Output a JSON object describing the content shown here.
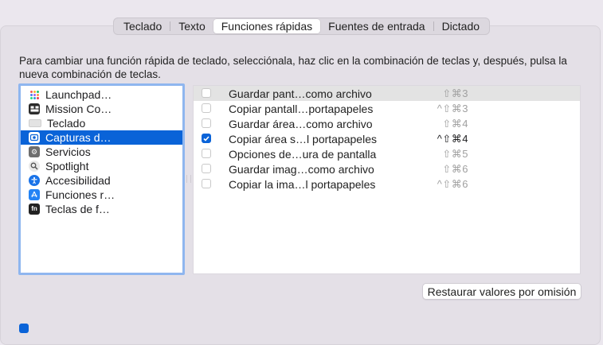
{
  "tabs": [
    {
      "label": "Teclado",
      "active": false
    },
    {
      "label": "Texto",
      "active": false
    },
    {
      "label": "Funciones rápidas",
      "active": true
    },
    {
      "label": "Fuentes de entrada",
      "active": false
    },
    {
      "label": "Dictado",
      "active": false
    }
  ],
  "instructions": "Para cambiar una función rápida de teclado, selecciónala, haz clic en la combinación de teclas y, después, pulsa la nueva combinación de teclas.",
  "categories": [
    {
      "label": "Launchpad…",
      "icon": "launchpad-icon"
    },
    {
      "label": "Mission Co…",
      "icon": "mission-control-icon"
    },
    {
      "label": "Teclado",
      "icon": "keyboard-icon"
    },
    {
      "label": "Capturas d…",
      "icon": "screenshot-icon",
      "selected": true
    },
    {
      "label": "Servicios",
      "icon": "gear-icon"
    },
    {
      "label": "Spotlight",
      "icon": "spotlight-icon"
    },
    {
      "label": "Accesibilidad",
      "icon": "accessibility-icon"
    },
    {
      "label": "Funciones r…",
      "icon": "app-store-icon"
    },
    {
      "label": "Teclas de f…",
      "icon": "fn-key-icon"
    }
  ],
  "shortcuts": [
    {
      "label": "Guardar pant…como archivo",
      "keys": "⇧⌘3",
      "checked": false
    },
    {
      "label": "Copiar pantall…portapapeles",
      "keys": "^⇧⌘3",
      "checked": false
    },
    {
      "label": "Guardar área…como archivo",
      "keys": "⇧⌘4",
      "checked": false
    },
    {
      "label": "Copiar área s…l portapapeles",
      "keys": "^⇧⌘4",
      "checked": true
    },
    {
      "label": "Opciones de…ura de pantalla",
      "keys": "⇧⌘5",
      "checked": false
    },
    {
      "label": "Guardar imag…como archivo",
      "keys": "⇧⌘6",
      "checked": false
    },
    {
      "label": "Copiar la ima…l portapapeles",
      "keys": "^⇧⌘6",
      "checked": false
    }
  ],
  "restore_button": "Restaurar valores por omisión",
  "colors": {
    "accent": "#0a63d8",
    "selection_border": "#8fb6ef"
  }
}
